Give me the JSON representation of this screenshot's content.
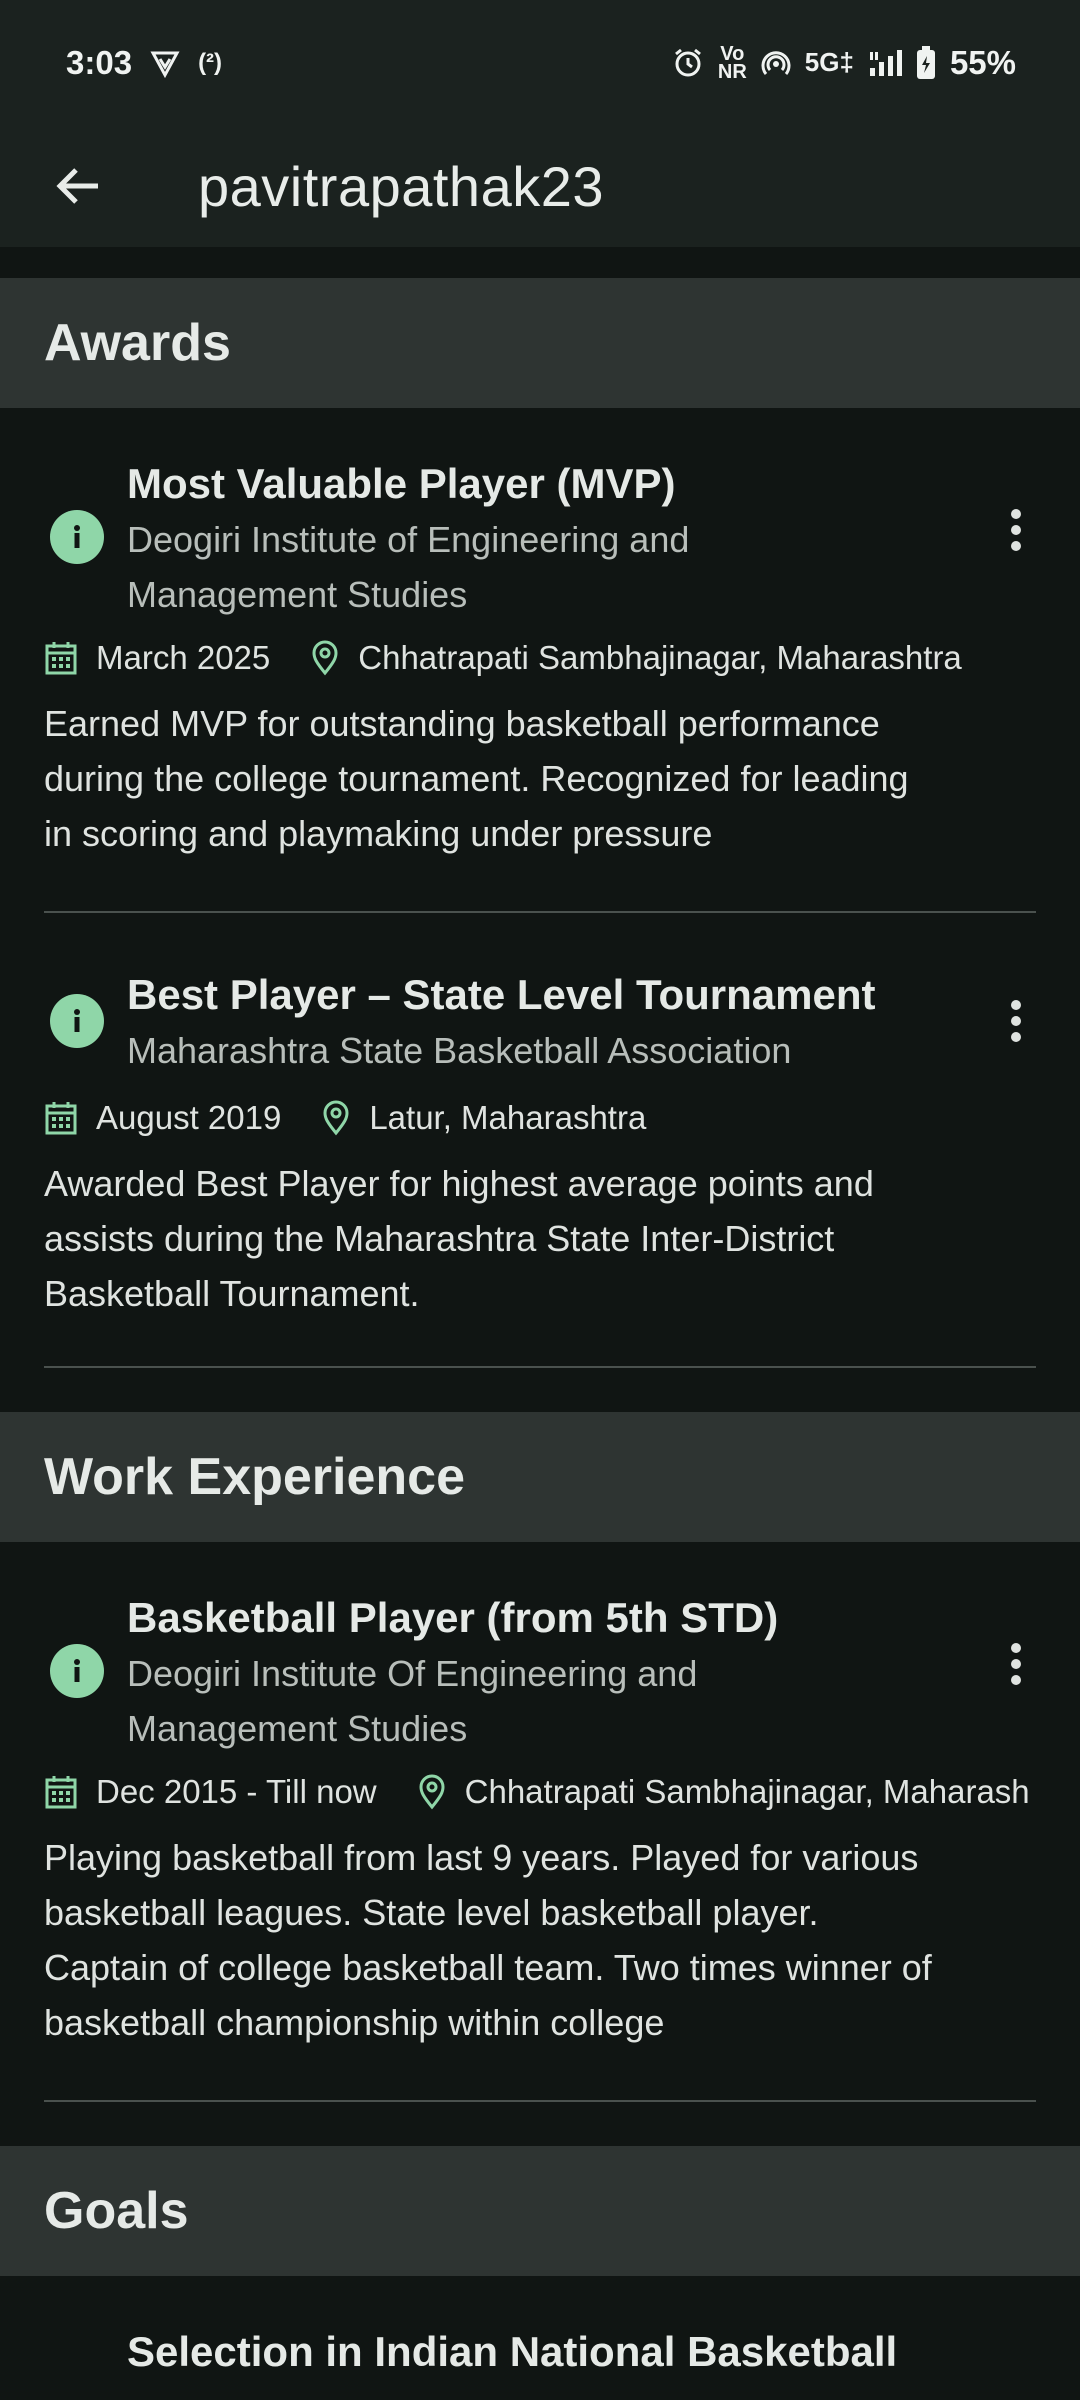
{
  "status_bar": {
    "time": "3:03",
    "sim_label": "(²)",
    "volte_top": "Vo",
    "volte_bottom": "NR",
    "network": "5G‡",
    "battery": "55%",
    "icons": [
      "vpn-shield-icon",
      "wifi-calling-icon",
      "alarm-icon",
      "hotspot-icon",
      "signal-icon",
      "battery-icon"
    ]
  },
  "app_bar": {
    "title": "pavitrapathak23",
    "back_icon": "arrow-back-icon"
  },
  "sections": {
    "awards": {
      "header": "Awards",
      "items": [
        {
          "title": "Most Valuable Player (MVP)",
          "org_line1": "Deogiri Institute of Engineering and",
          "org_line2": "Management Studies",
          "date": "March 2025",
          "location": "Chhatrapati Sambhajinagar, Maharashtra",
          "desc_lines": [
            "Earned MVP for outstanding basketball performance",
            "during the college tournament. Recognized for leading",
            "in scoring and playmaking under pressure"
          ]
        },
        {
          "title": "Best Player – State Level Tournament",
          "org_line1": "Maharashtra State Basketball Association",
          "date": "August 2019",
          "location": "Latur, Maharashtra",
          "desc_lines": [
            "Awarded Best Player for highest average points and",
            "assists during the Maharashtra State Inter-District",
            "Basketball Tournament."
          ]
        }
      ]
    },
    "work": {
      "header": "Work Experience",
      "items": [
        {
          "title": "Basketball Player (from 5th STD)",
          "org_line1": "Deogiri Institute Of Engineering and",
          "org_line2": "Management Studies",
          "date": "Dec 2015 - Till now",
          "location": "Chhatrapati Sambhajinagar, Maharash",
          "desc_lines": [
            "Playing basketball from last 9 years. Played for various",
            "basketball leagues. State level basketball player.",
            "Captain of college basketball team. Two times winner of",
            "basketball championship within college"
          ]
        }
      ]
    },
    "goals": {
      "header": "Goals",
      "items": [
        {
          "title": "Selection in Indian National Basketball"
        }
      ]
    }
  },
  "colors": {
    "background": "#101513",
    "section_header": "#2e3432",
    "info_icon": "#8fd6a8",
    "bar": "#1b221f"
  }
}
